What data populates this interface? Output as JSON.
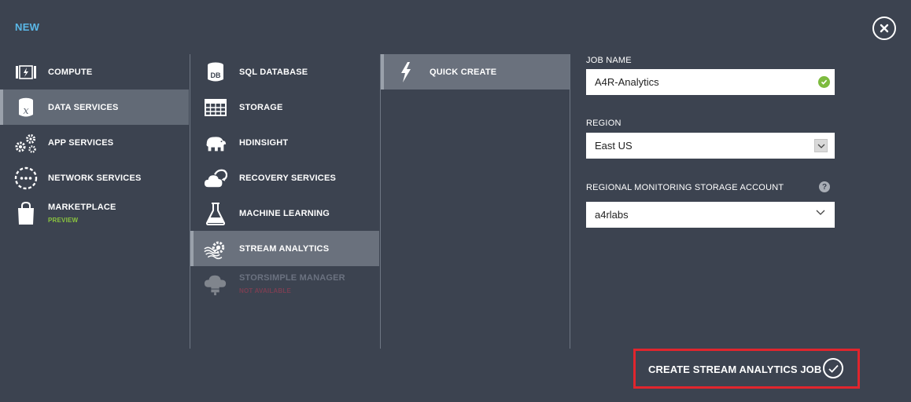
{
  "header": {
    "title": "NEW"
  },
  "categories": [
    {
      "label": "COMPUTE",
      "icon": "compute-icon"
    },
    {
      "label": "DATA SERVICES",
      "icon": "data-services-icon",
      "selected": true
    },
    {
      "label": "APP SERVICES",
      "icon": "app-services-icon"
    },
    {
      "label": "NETWORK SERVICES",
      "icon": "network-services-icon"
    },
    {
      "label": "MARKETPLACE",
      "sublabel": "PREVIEW",
      "icon": "marketplace-icon"
    }
  ],
  "services": [
    {
      "label": "SQL DATABASE",
      "icon": "sql-database-icon"
    },
    {
      "label": "STORAGE",
      "icon": "storage-icon"
    },
    {
      "label": "HDINSIGHT",
      "icon": "hdinsight-icon"
    },
    {
      "label": "RECOVERY SERVICES",
      "icon": "recovery-services-icon"
    },
    {
      "label": "MACHINE LEARNING",
      "icon": "machine-learning-icon"
    },
    {
      "label": "STREAM ANALYTICS",
      "icon": "stream-analytics-icon",
      "selected": true
    },
    {
      "label": "STORSIMPLE MANAGER",
      "sublabel": "NOT AVAILABLE",
      "icon": "storsimple-icon",
      "disabled": true
    }
  ],
  "actions": [
    {
      "label": "QUICK CREATE",
      "icon": "lightning-icon",
      "selected": true
    }
  ],
  "form": {
    "job_name_label": "JOB NAME",
    "job_name_value": "A4R-Analytics",
    "region_label": "REGION",
    "region_value": "East US",
    "storage_label": "REGIONAL MONITORING STORAGE ACCOUNT",
    "storage_value": "a4rlabs",
    "help_glyph": "?"
  },
  "footer": {
    "create_label": "CREATE STREAM ANALYTICS JOB"
  },
  "colors": {
    "background": "#3c4350",
    "selected": "#626a76",
    "accent_title": "#5ab8e8",
    "preview": "#8ac43f",
    "not_available": "#7a3f52",
    "valid": "#7dbb3f",
    "highlight_box": "#e0252d"
  }
}
